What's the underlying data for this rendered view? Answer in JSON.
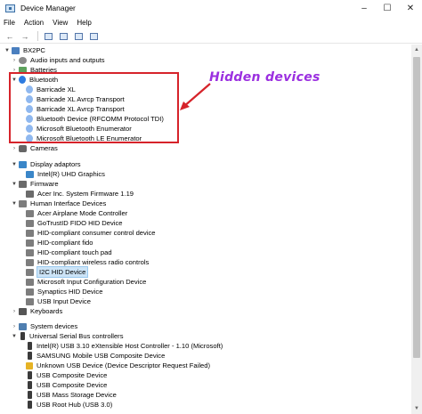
{
  "window": {
    "title": "Device Manager",
    "controls": {
      "minimize": "–",
      "maximize": "☐",
      "close": "✕"
    }
  },
  "menu": [
    "File",
    "Action",
    "View",
    "Help"
  ],
  "toolbar": {
    "back": "←",
    "forward": "→"
  },
  "tree": {
    "root": "BX2PC",
    "items": [
      {
        "label": "Audio inputs and outputs",
        "icon": "speaker-icon"
      },
      {
        "label": "Batteries",
        "icon": "battery-icon"
      },
      {
        "label": "Bluetooth",
        "icon": "bluetooth-icon"
      },
      {
        "label": "Barricade XL",
        "icon": "bluetooth-icon"
      },
      {
        "label": "Barricade XL Avrcp Transport",
        "icon": "bluetooth-icon"
      },
      {
        "label": "Barricade XL Avrcp Transport",
        "icon": "bluetooth-icon"
      },
      {
        "label": "Bluetooth Device (RFCOMM Protocol TDI)",
        "icon": "bluetooth-icon"
      },
      {
        "label": "Microsoft Bluetooth Enumerator",
        "icon": "bluetooth-icon"
      },
      {
        "label": "Microsoft Bluetooth LE Enumerator",
        "icon": "bluetooth-icon"
      },
      {
        "label": "Cameras",
        "icon": "camera-icon"
      },
      {
        "label": "Display adaptors",
        "icon": "monitor-icon"
      },
      {
        "label": "Intel(R) UHD Graphics",
        "icon": "monitor-icon"
      },
      {
        "label": "Firmware",
        "icon": "chip-icon"
      },
      {
        "label": "Acer Inc. System Firmware 1.19",
        "icon": "chip-icon"
      },
      {
        "label": "Human Interface Devices",
        "icon": "hid-icon"
      },
      {
        "label": "Acer Airplane Mode Controller",
        "icon": "hid-icon"
      },
      {
        "label": "GoTrustID FIDO HID Device",
        "icon": "hid-icon"
      },
      {
        "label": "HID-compliant consumer control device",
        "icon": "hid-icon"
      },
      {
        "label": "HID-compliant fido",
        "icon": "hid-icon"
      },
      {
        "label": "HID-compliant touch pad",
        "icon": "hid-icon"
      },
      {
        "label": "HID-compliant wireless radio controls",
        "icon": "hid-icon"
      },
      {
        "label": "I2C HID Device",
        "icon": "hid-icon"
      },
      {
        "label": "Microsoft Input Configuration Device",
        "icon": "hid-icon"
      },
      {
        "label": "Synaptics HID Device",
        "icon": "hid-icon"
      },
      {
        "label": "USB Input Device",
        "icon": "hid-icon"
      },
      {
        "label": "Keyboards",
        "icon": "keyboard-icon"
      },
      {
        "label": "System devices",
        "icon": "system-icon"
      },
      {
        "label": "Universal Serial Bus controllers",
        "icon": "usb-icon"
      },
      {
        "label": "Intel(R) USB 3.10 eXtensible Host Controller - 1.10 (Microsoft)",
        "icon": "usb-icon"
      },
      {
        "label": "SAMSUNG Mobile USB Composite Device",
        "icon": "usb-icon"
      },
      {
        "label": "Unknown USB Device (Device Descriptor Request Failed)",
        "icon": "warning-icon"
      },
      {
        "label": "USB Composite Device",
        "icon": "usb-icon"
      },
      {
        "label": "USB Composite Device",
        "icon": "usb-icon"
      },
      {
        "label": "USB Mass Storage Device",
        "icon": "usb-icon"
      },
      {
        "label": "USB Root Hub (USB 3.0)",
        "icon": "usb-icon"
      }
    ]
  },
  "annotation": "Hidden devices",
  "colors": {
    "highlight_border": "#d6232a",
    "annotation_text": "#9b2fe0",
    "selection": "#cce4f7"
  }
}
